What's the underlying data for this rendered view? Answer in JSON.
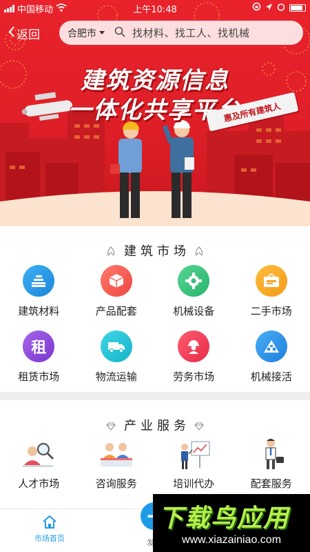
{
  "status_bar": {
    "carrier": "中国移动",
    "time": "上午10:48"
  },
  "nav": {
    "back_label": "返回",
    "city": "合肥市",
    "search_placeholder": "找材料、找工人、找机械"
  },
  "hero": {
    "title_line1": "建筑资源信息",
    "title_line2": "一体化共享平台",
    "ribbon": "惠及所有建筑人"
  },
  "market": {
    "title": "建筑市场",
    "items": [
      {
        "label": "建筑材料",
        "icon": "materials-icon",
        "color": "#1d8fe0"
      },
      {
        "label": "产品配套",
        "icon": "box-icon",
        "color": "#f25a4e"
      },
      {
        "label": "机械设备",
        "icon": "gear-icon",
        "color": "#3cc37b"
      },
      {
        "label": "二手市场",
        "icon": "tag-icon",
        "color": "#f6a623"
      },
      {
        "label": "租赁市场",
        "icon": "rent-icon",
        "color": "#8b47d9"
      },
      {
        "label": "物流运输",
        "icon": "truck-icon",
        "color": "#1ec3d6"
      },
      {
        "label": "劳务市场",
        "icon": "worker-icon",
        "color": "#ee3b55"
      },
      {
        "label": "机械接活",
        "icon": "crane-icon",
        "color": "#2c8ee8"
      }
    ]
  },
  "services": {
    "title": "产业服务",
    "items": [
      {
        "label": "人才市场",
        "icon": "talent-icon"
      },
      {
        "label": "咨询服务",
        "icon": "consult-icon"
      },
      {
        "label": "培训代办",
        "icon": "training-icon"
      },
      {
        "label": "配套服务",
        "icon": "service-icon"
      }
    ]
  },
  "tabbar": {
    "home": "市场首页",
    "publish": "发"
  },
  "watermark": {
    "title": "下载鸟应用",
    "url": "www.xiazainiao.com"
  },
  "colors": {
    "brand_red": "#e4222b",
    "accent_blue": "#1e9be8"
  }
}
